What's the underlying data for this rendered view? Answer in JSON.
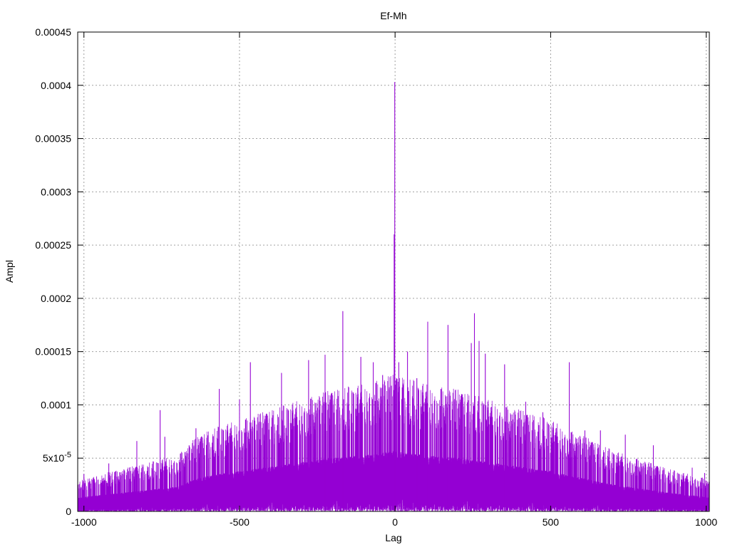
{
  "chart_data": {
    "type": "line",
    "title": "Ef-Mh",
    "xlabel": "Lag",
    "ylabel": "Ampl",
    "xlim": [
      -1020,
      1010
    ],
    "ylim": [
      0,
      0.00045
    ],
    "grid": true,
    "x_ticks": [
      {
        "value": -1000,
        "label": "-1000"
      },
      {
        "value": -500,
        "label": "-500"
      },
      {
        "value": 0,
        "label": "0"
      },
      {
        "value": 500,
        "label": "500"
      },
      {
        "value": 1000,
        "label": "1000"
      }
    ],
    "y_ticks": [
      {
        "value": 0,
        "label": "0"
      },
      {
        "value": 5e-05,
        "label": "5x10",
        "sup": "-5"
      },
      {
        "value": 0.0001,
        "label": "0.0001"
      },
      {
        "value": 0.00015,
        "label": "0.00015"
      },
      {
        "value": 0.0002,
        "label": "0.0002"
      },
      {
        "value": 0.00025,
        "label": "0.00025"
      },
      {
        "value": 0.0003,
        "label": "0.0003"
      },
      {
        "value": 0.00035,
        "label": "0.00035"
      },
      {
        "value": 0.0004,
        "label": "0.0004"
      },
      {
        "value": 0.00045,
        "label": "0.00045"
      }
    ],
    "series": [
      {
        "color": "#9400d3",
        "sample_step": 25,
        "envelope": {
          "x": [
            -1020,
            -1000,
            -900,
            -800,
            -700,
            -650,
            -600,
            -500,
            -400,
            -300,
            -200,
            -100,
            0,
            100,
            200,
            300,
            400,
            500,
            560,
            600,
            700,
            800,
            900,
            1000,
            1010
          ],
          "y": [
            1.2e-05,
            1.3e-05,
            1.6e-05,
            1.9e-05,
            2.2e-05,
            2.8e-05,
            3.2e-05,
            3.6e-05,
            4e-05,
            4.4e-05,
            4.8e-05,
            5e-05,
            5.4e-05,
            5e-05,
            4.8e-05,
            4.4e-05,
            4e-05,
            3.6e-05,
            3.2e-05,
            3e-05,
            2.4e-05,
            2e-05,
            1.6e-05,
            1.3e-05,
            1.2e-05
          ]
        },
        "peaks": [
          {
            "x": -1000,
            "y": 3.5e-05
          },
          {
            "x": -920,
            "y": 4.5e-05
          },
          {
            "x": -830,
            "y": 6.6e-05
          },
          {
            "x": -755,
            "y": 9.5e-05
          },
          {
            "x": -740,
            "y": 7e-05
          },
          {
            "x": -640,
            "y": 7.8e-05
          },
          {
            "x": -565,
            "y": 0.000115
          },
          {
            "x": -500,
            "y": 0.000105
          },
          {
            "x": -465,
            "y": 0.00014
          },
          {
            "x": -365,
            "y": 0.00013
          },
          {
            "x": -278,
            "y": 0.000142
          },
          {
            "x": -225,
            "y": 0.000147
          },
          {
            "x": -168,
            "y": 0.000188
          },
          {
            "x": -110,
            "y": 0.000145
          },
          {
            "x": -70,
            "y": 0.00014
          },
          {
            "x": -40,
            "y": 0.000128
          },
          {
            "x": -12,
            "y": 0.000118
          },
          {
            "x": -3,
            "y": 0.00026
          },
          {
            "x": -1,
            "y": 0.000403
          },
          {
            "x": 12,
            "y": 0.00014
          },
          {
            "x": 25,
            "y": 0.00012
          },
          {
            "x": 40,
            "y": 0.00015
          },
          {
            "x": 70,
            "y": 0.000125
          },
          {
            "x": 105,
            "y": 0.000178
          },
          {
            "x": 170,
            "y": 0.000175
          },
          {
            "x": 245,
            "y": 0.000158
          },
          {
            "x": 255,
            "y": 0.000186
          },
          {
            "x": 270,
            "y": 0.00016
          },
          {
            "x": 290,
            "y": 0.000148
          },
          {
            "x": 352,
            "y": 0.000138
          },
          {
            "x": 420,
            "y": 0.000103
          },
          {
            "x": 475,
            "y": 9.3e-05
          },
          {
            "x": 560,
            "y": 0.00014
          },
          {
            "x": 610,
            "y": 7.6e-05
          },
          {
            "x": 660,
            "y": 7.6e-05
          },
          {
            "x": 740,
            "y": 7.2e-05
          },
          {
            "x": 830,
            "y": 6.2e-05
          },
          {
            "x": 955,
            "y": 4.1e-05
          },
          {
            "x": 995,
            "y": 3.6e-05
          }
        ]
      }
    ]
  }
}
